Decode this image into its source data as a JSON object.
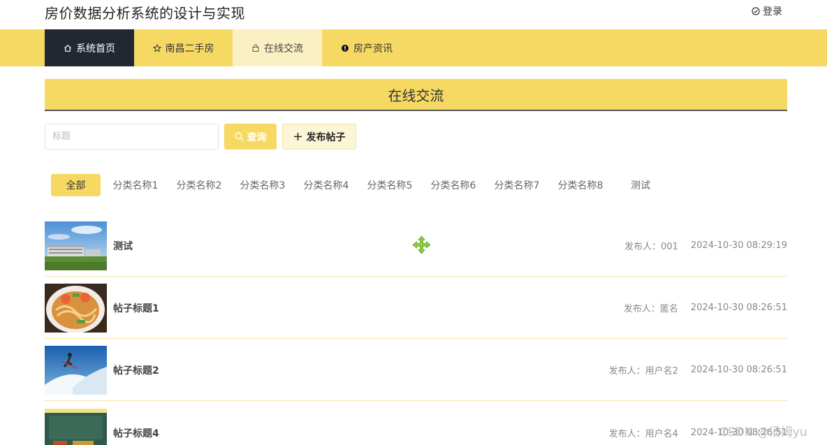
{
  "header": {
    "site_title": "房价数据分析系统的设计与实现",
    "login_label": "登录"
  },
  "nav": [
    {
      "label": "系统首页",
      "icon": "home-icon"
    },
    {
      "label": "南昌二手房",
      "icon": "star-icon"
    },
    {
      "label": "在线交流",
      "icon": "bag-icon"
    },
    {
      "label": "房产资讯",
      "icon": "info-icon"
    }
  ],
  "section": {
    "title": "在线交流"
  },
  "search": {
    "placeholder": "标题",
    "search_label": "查询",
    "post_label": "发布帖子"
  },
  "categories": [
    "全部",
    "分类名称1",
    "分类名称2",
    "分类名称3",
    "分类名称4",
    "分类名称5",
    "分类名称6",
    "分类名称7",
    "分类名称8",
    "测试"
  ],
  "posts": [
    {
      "title": "测试",
      "author": "发布人：001",
      "time": "2024-10-30 08:29:19"
    },
    {
      "title": "帖子标题1",
      "author": "发布人：匿名",
      "time": "2024-10-30 08:26:51"
    },
    {
      "title": "帖子标题2",
      "author": "发布人：用户名2",
      "time": "2024-10-30 08:26:51"
    },
    {
      "title": "帖子标题4",
      "author": "发布人：用户名4",
      "time": "2024-10-30 08:26:51"
    }
  ],
  "watermark": "CSDN @汤姆yu",
  "colors": {
    "accent": "#f6d963",
    "nav_active": "#222831",
    "nav_current": "#fbf0c4"
  }
}
